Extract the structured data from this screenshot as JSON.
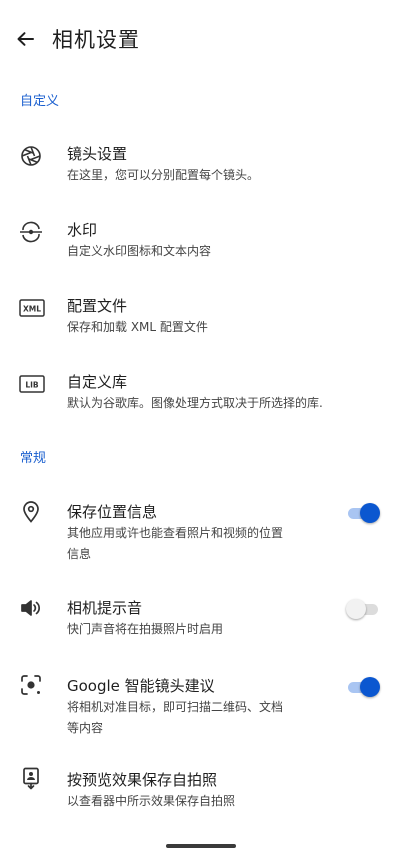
{
  "header": {
    "title": "相机设置",
    "back_icon": "arrow-left-icon"
  },
  "sections": {
    "custom": "自定义",
    "general": "常规"
  },
  "custom_items": [
    {
      "title": "镜头设置",
      "subtitle": "在这里，您可以分别配置每个镜头。",
      "icon": "aperture-icon"
    },
    {
      "title": "水印",
      "subtitle": "自定义水印图标和文本内容",
      "icon": "watermark-icon"
    },
    {
      "title": "配置文件",
      "subtitle": "保存和加载 XML 配置文件",
      "icon": "xml-file-icon",
      "icon_text": "XML"
    },
    {
      "title": "自定义库",
      "subtitle": "默认为谷歌库。图像处理方式取决于所选择的库.",
      "icon": "lib-icon",
      "icon_text": "LIB"
    }
  ],
  "general_items": [
    {
      "title": "保存位置信息",
      "subtitle_line1": "其他应用或许也能查看照片和视频的位置",
      "subtitle_line2": "信息",
      "icon": "location-pin-icon",
      "toggle": true
    },
    {
      "title": "相机提示音",
      "subtitle_line1": "快门声音将在拍摄照片时启用",
      "icon": "speaker-icon",
      "toggle": false
    },
    {
      "title": "Google 智能镜头建议",
      "subtitle_line1": "将相机对准目标，即可扫描二维码、文档",
      "subtitle_line2": "等内容",
      "icon": "lens-icon",
      "toggle": true
    },
    {
      "title": "按预览效果保存自拍照",
      "subtitle_line1": "以查看器中所示效果保存自拍照",
      "icon": "selfie-icon"
    }
  ],
  "colors": {
    "accent": "#0b57d0",
    "section_label": "#1a5fcf",
    "toggle_on_track": "#a9c5f2",
    "toggle_off_track": "#dcdcdc"
  }
}
